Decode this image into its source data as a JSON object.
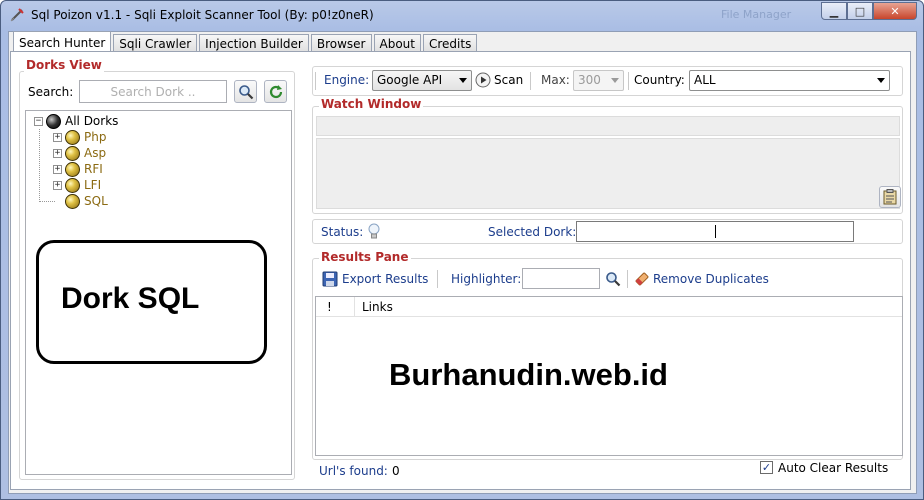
{
  "window": {
    "title": "Sql Poizon v1.1 - Sqli Exploit Scanner Tool (By: p0!z0neR)",
    "ghost_title": "File Manager",
    "minimize": "▁",
    "maximize": "□",
    "close": "✕"
  },
  "tabs": [
    {
      "label": "Search Hunter",
      "active": true
    },
    {
      "label": "Sqli Crawler"
    },
    {
      "label": "Injection Builder"
    },
    {
      "label": "Browser"
    },
    {
      "label": "About"
    },
    {
      "label": "Credits"
    }
  ],
  "dorks_view": {
    "title": "Dorks View",
    "search_label": "Search:",
    "search_placeholder": "Search Dork ..",
    "search_icon": "magnifier-icon",
    "refresh_icon": "refresh-icon",
    "tree": {
      "root": "All Dorks",
      "children": [
        "Php",
        "Asp",
        "RFI",
        "LFI",
        "SQL"
      ]
    }
  },
  "overlay_text": "Dork SQL",
  "toolbar": {
    "engine_label": "Engine:",
    "engine_value": "Google API",
    "scan_label": "Scan",
    "max_label": "Max:",
    "max_value": "300",
    "country_label": "Country:",
    "country_value": "ALL"
  },
  "watch_window": {
    "title": "Watch Window",
    "clipboard_icon": "clipboard-icon"
  },
  "status_bar": {
    "status_label": "Status:",
    "status_icon": "lightbulb-icon",
    "selected_dork_label": "Selected Dork:",
    "selected_dork_value": ""
  },
  "results_pane": {
    "title": "Results Pane",
    "export_label": "Export Results",
    "highlighter_label": "Highlighter:",
    "highlighter_value": "",
    "remove_duplicates_label": "Remove Duplicates",
    "columns": [
      "!",
      "Links"
    ],
    "rows": []
  },
  "watermark": "Burhanudin.web.id",
  "footer": {
    "urls_found_label": "Url's found:",
    "urls_found_value": "0",
    "auto_clear_label": "Auto Clear Results",
    "auto_clear_checked": true
  },
  "colors": {
    "group_title": "#b22a2a",
    "label_blue": "#1c3d8c",
    "node_label": "#8b6a12"
  }
}
